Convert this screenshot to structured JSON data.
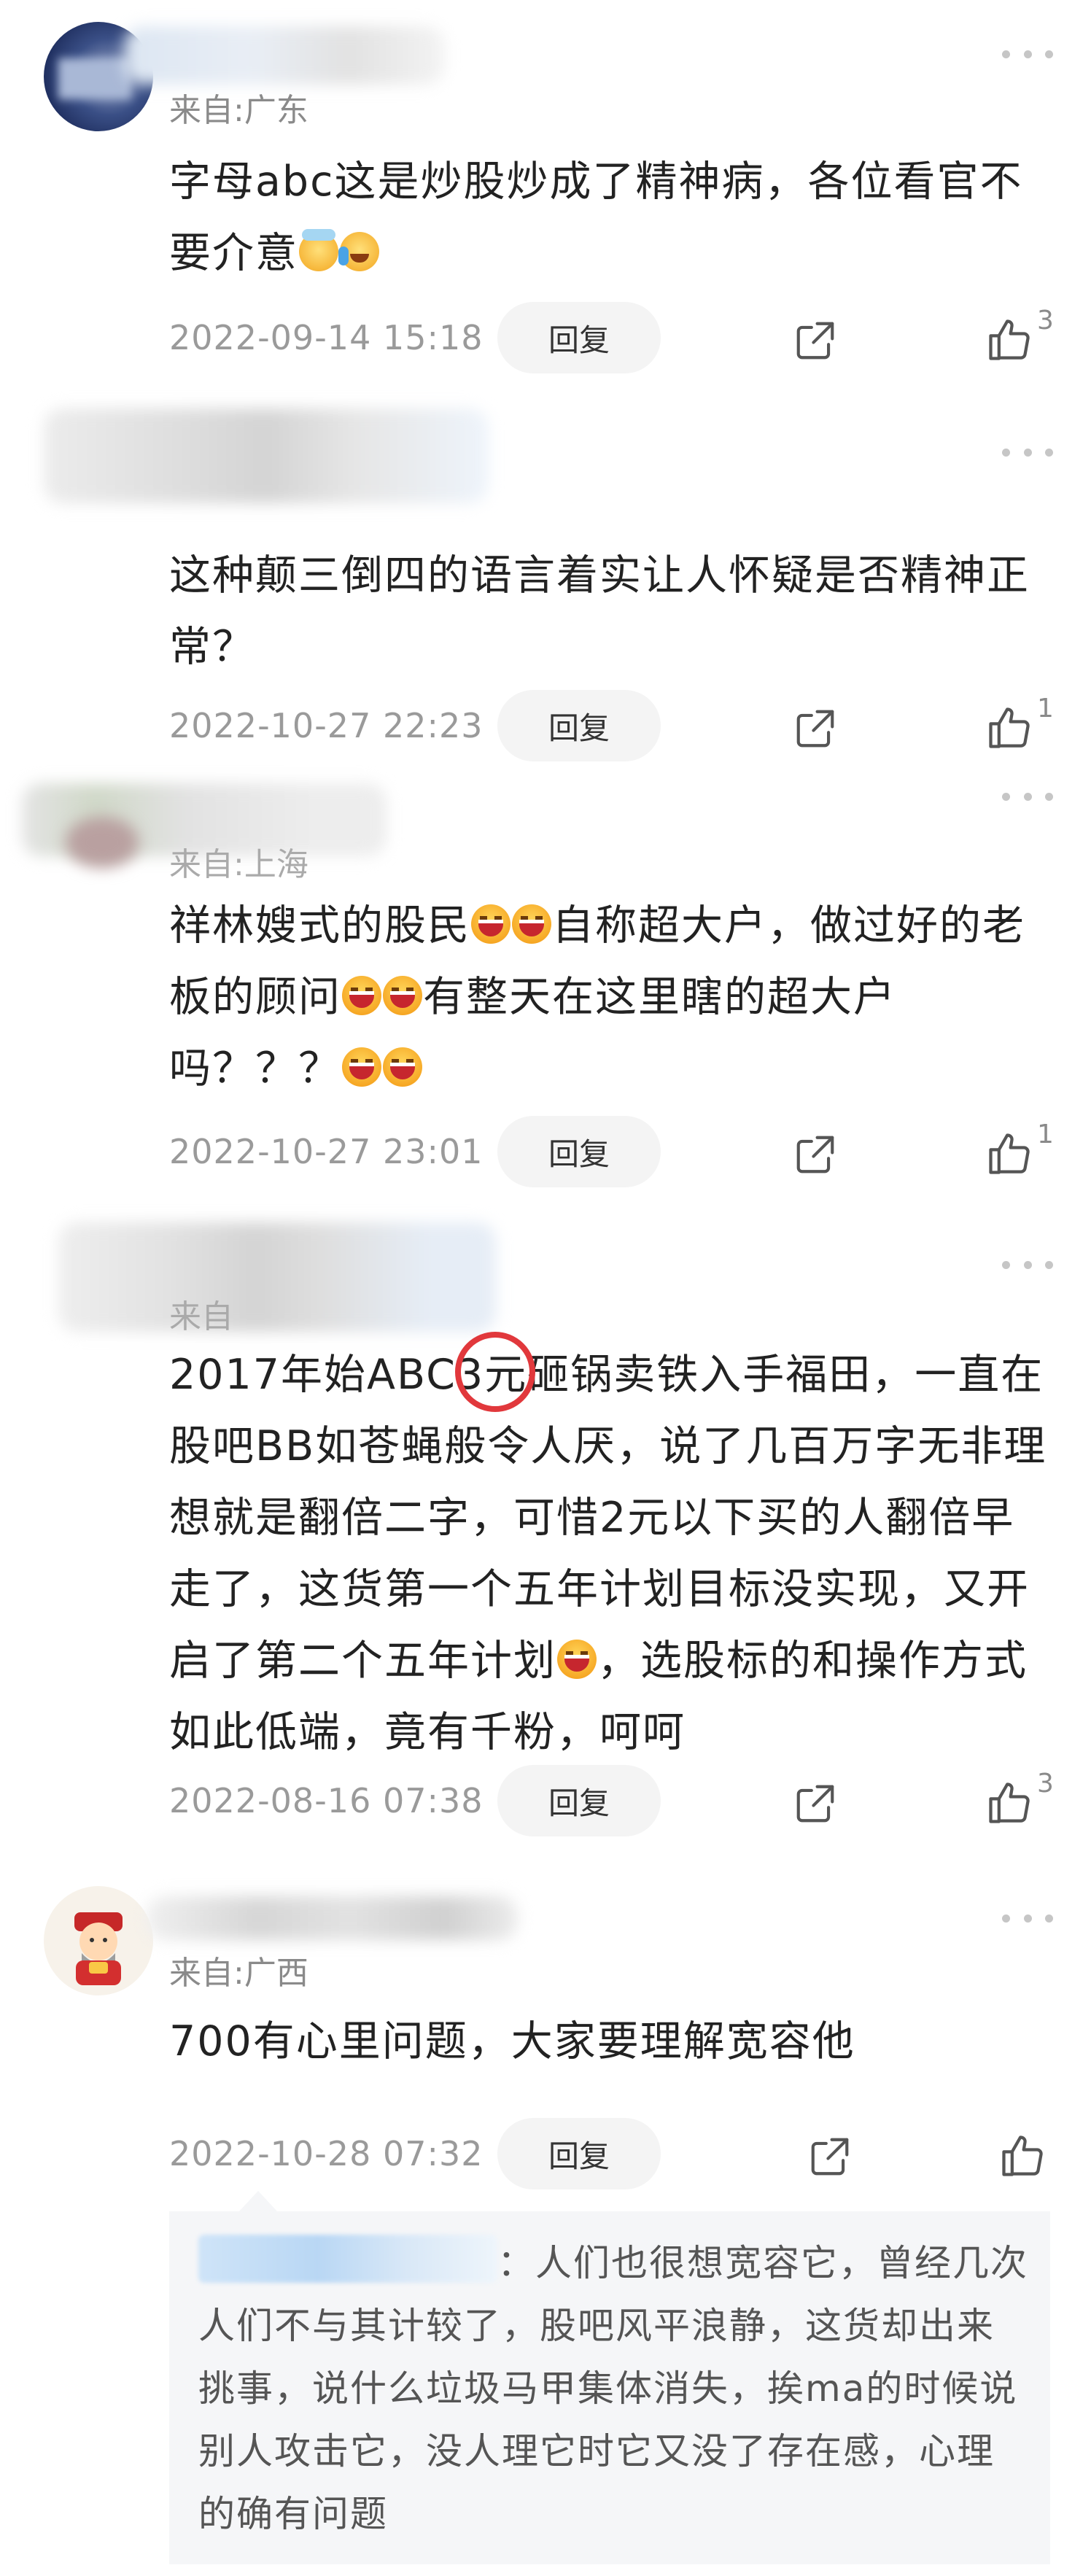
{
  "comments": [
    {
      "location": "来自:广东",
      "text": "字母abc这是炒股炒成了精神病，各位看官不要介意",
      "timestamp": "2022-09-14 15:18",
      "reply_label": "回复",
      "likes": "3"
    },
    {
      "location": "",
      "text": "这种颠三倒四的语言着实让人怀疑是否精神正常？",
      "timestamp": "2022-10-27 22:23",
      "reply_label": "回复",
      "likes": "1"
    },
    {
      "location": "来自:上海",
      "text_parts": [
        "祥林嫂式的股民",
        "自称超大户，做过好的老板的顾问",
        "有整天在这里瞎的超大户吗？？？"
      ],
      "timestamp": "2022-10-27 23:01",
      "reply_label": "回复",
      "likes": "1"
    },
    {
      "location": "来自",
      "text_parts": [
        "2017年始ABC3元砸锅卖铁入手福田，一直在股吧BB如苍蝇般令人厌，说了几百万字无非理想就是翻倍二字，可惜2元以下买的人翻倍早走了，这货第一个五年计划目标没实现，又开启了第二个五年计划",
        "，选股标的和操作方式如此低端，竟有千粉，呵呵"
      ],
      "timestamp": "2022-08-16 07:38",
      "reply_label": "回复",
      "likes": "3"
    },
    {
      "location": "来自:广西",
      "text": "700有心里问题，大家要理解宽容他",
      "timestamp": "2022-10-28 07:32",
      "reply_label": "回复",
      "likes": ""
    }
  ],
  "reply": {
    "text": "：人们也很想宽容它，曾经几次人们不与其计较了，股吧风平浪静，这货却出来挑事，说什么垃圾马甲集体消失，挨ma的时候说别人攻击它，没人理它时它又没了存在感，心理的确有问题"
  },
  "icons": {
    "more": "more-dots-icon",
    "share": "share-icon",
    "like": "thumbs-up-icon"
  },
  "colors": {
    "highlight_circle": "#e1383c",
    "reply_box_bg": "#f5f6f8"
  }
}
